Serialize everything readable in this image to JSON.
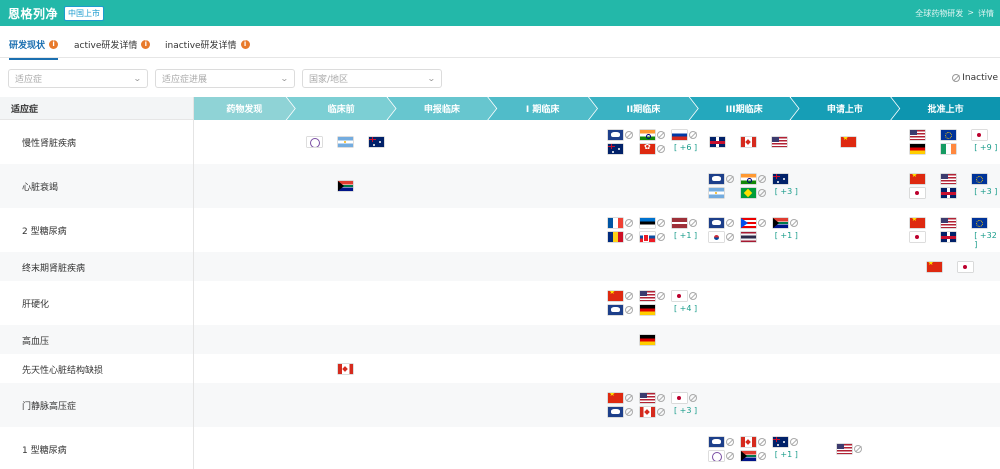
{
  "header": {
    "title": "恩格列净",
    "badge": "中国上市",
    "crumb_parent": "全球药物研发",
    "crumb_sep": ">",
    "crumb_current": "详情",
    "bg_color": "#23b8a9"
  },
  "tabs": [
    {
      "label": "研发现状",
      "active": true
    },
    {
      "label": "active研发详情",
      "active": false
    },
    {
      "label": "inactive研发详情",
      "active": false
    }
  ],
  "filters": {
    "indication_placeholder": "适应症",
    "progress_placeholder": "适应症进展",
    "region_placeholder": "国家/地区",
    "inactive_legend": "Inactive"
  },
  "table": {
    "indication_header": "适应症",
    "phases": [
      "药物发现",
      "临床前",
      "申报临床",
      "I 期临床",
      "II期临床",
      "III期临床",
      "申请上市",
      "批准上市"
    ],
    "phase_colors": [
      "#8fd3d6",
      "#7ccfd4",
      "#67c6cf",
      "#50bcc9",
      "#3ab2c3",
      "#24a8bd",
      "#169eb6",
      "#0d95af"
    ],
    "rows": [
      {
        "label": "慢性肾脏疾病",
        "cells": {
          "1": [
            {
              "c": "tw"
            },
            {
              "c": "ar"
            },
            {
              "c": "au"
            }
          ],
          "4": [
            {
              "c": "org",
              "x": true
            },
            {
              "c": "in",
              "x": true
            },
            {
              "c": "ru",
              "x": true
            },
            {
              "c": "au"
            },
            {
              "c": "hk",
              "x": true
            }
          ],
          "4_more": "[ +6 ]",
          "5": [
            {
              "c": "gb"
            },
            {
              "c": "ca"
            },
            {
              "c": "us"
            }
          ],
          "6": [
            {
              "c": "cn"
            }
          ],
          "7": [
            {
              "c": "us"
            },
            {
              "c": "eu"
            },
            {
              "c": "jp"
            },
            {
              "c": "de"
            },
            {
              "c": "ie"
            }
          ],
          "7_more": "[ +9 ]"
        }
      },
      {
        "label": "心脏衰竭",
        "cells": {
          "1": [
            {
              "c": "za"
            }
          ],
          "5": [
            {
              "c": "org",
              "x": true
            },
            {
              "c": "in",
              "x": true
            },
            {
              "c": "au"
            },
            {
              "c": "ar"
            },
            {
              "c": "br",
              "x": true
            }
          ],
          "5_more": "[ +3 ]",
          "7": [
            {
              "c": "cn"
            },
            {
              "c": "us"
            },
            {
              "c": "eu"
            },
            {
              "c": "jp"
            },
            {
              "c": "gb"
            }
          ],
          "7_more": "[ +3 ]"
        }
      },
      {
        "label": "2 型糖尿病",
        "cells": {
          "4": [
            {
              "c": "fr",
              "x": true
            },
            {
              "c": "ee",
              "x": true
            },
            {
              "c": "lv",
              "x": true
            },
            {
              "c": "ro",
              "x": true
            },
            {
              "c": "sk",
              "x": true
            }
          ],
          "4_more": "[ +1 ]",
          "5": [
            {
              "c": "org",
              "x": true
            },
            {
              "c": "pr",
              "x": true
            },
            {
              "c": "za",
              "x": true
            },
            {
              "c": "kr",
              "x": true
            },
            {
              "c": "th"
            }
          ],
          "5_more": "[ +1 ]",
          "7": [
            {
              "c": "cn"
            },
            {
              "c": "us"
            },
            {
              "c": "eu"
            },
            {
              "c": "jp"
            },
            {
              "c": "gb"
            }
          ],
          "7_more": "[ +32 ]"
        }
      },
      {
        "label": "终末期肾脏疾病",
        "cells": {
          "7": [
            {
              "c": "cn"
            },
            {
              "c": "jp"
            }
          ]
        }
      },
      {
        "label": "肝硬化",
        "cells": {
          "4": [
            {
              "c": "cn",
              "x": true
            },
            {
              "c": "us",
              "x": true
            },
            {
              "c": "jp",
              "x": true
            },
            {
              "c": "org",
              "x": true
            },
            {
              "c": "de"
            }
          ],
          "4_more": "[ +4 ]"
        }
      },
      {
        "label": "高血压",
        "cells": {
          "4": [
            {
              "c": "de"
            }
          ]
        }
      },
      {
        "label": "先天性心脏结构缺损",
        "cells": {
          "1": [
            {
              "c": "ca"
            }
          ]
        }
      },
      {
        "label": "门静脉高压症",
        "cells": {
          "4": [
            {
              "c": "cn",
              "x": true
            },
            {
              "c": "us",
              "x": true
            },
            {
              "c": "jp",
              "x": true
            },
            {
              "c": "org",
              "x": true
            },
            {
              "c": "ca",
              "x": true
            }
          ],
          "4_more": "[ +3 ]"
        }
      },
      {
        "label": "1 型糖尿病",
        "cells": {
          "5": [
            {
              "c": "org",
              "x": true
            },
            {
              "c": "ca",
              "x": true
            },
            {
              "c": "au",
              "x": true
            },
            {
              "c": "tw",
              "x": true
            },
            {
              "c": "za",
              "x": true
            }
          ],
          "5_more": "[ +1 ]",
          "6": [
            {
              "c": "us",
              "x": true
            }
          ]
        }
      }
    ]
  }
}
